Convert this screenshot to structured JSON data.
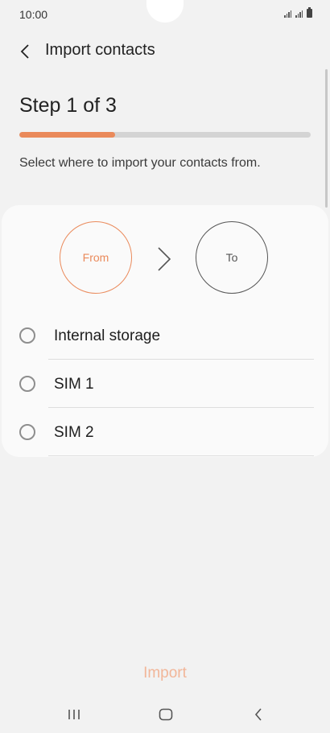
{
  "status_bar": {
    "time": "10:00"
  },
  "app_bar": {
    "title": "Import contacts"
  },
  "step": {
    "label": "Step 1 of 3",
    "progress_fraction": 0.33,
    "instruction": "Select where to import your contacts from."
  },
  "flow": {
    "from_label": "From",
    "to_label": "To"
  },
  "options": [
    {
      "label": "Internal storage",
      "selected": false
    },
    {
      "label": "SIM 1",
      "selected": false
    },
    {
      "label": "SIM 2",
      "selected": false
    }
  ],
  "actions": {
    "import_label": "Import"
  },
  "colors": {
    "accent": "#ea8a5b",
    "accent_disabled": "#f2b699",
    "background": "#f2f2f2"
  },
  "icons": {
    "back": "chevron-left-icon",
    "flow_arrow": "chevron-right-icon",
    "nav_recents": "recents-icon",
    "nav_home": "home-icon",
    "nav_back": "back-icon"
  }
}
